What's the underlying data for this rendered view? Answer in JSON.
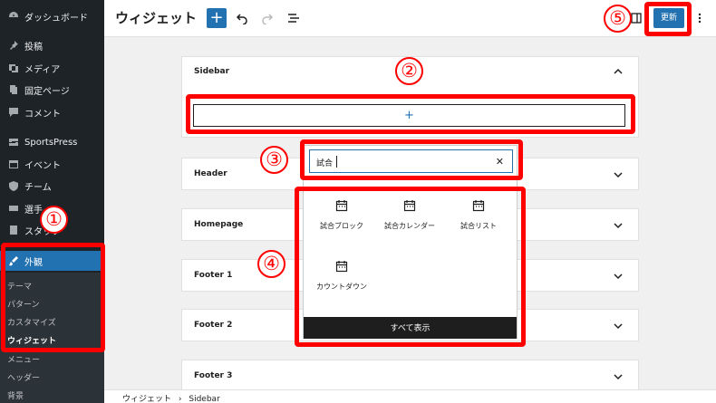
{
  "sidebar": {
    "items": [
      {
        "label": "ダッシュボード",
        "icon": "dashboard-icon"
      },
      {
        "label": "投稿",
        "icon": "pin-icon"
      },
      {
        "label": "メディア",
        "icon": "media-icon"
      },
      {
        "label": "固定ページ",
        "icon": "page-icon"
      },
      {
        "label": "コメント",
        "icon": "comment-icon"
      },
      {
        "label": "SportsPress",
        "icon": "sportspress-icon"
      },
      {
        "label": "イベント",
        "icon": "calendar-icon"
      },
      {
        "label": "チーム",
        "icon": "shield-icon"
      },
      {
        "label": "選手",
        "icon": "player-icon"
      },
      {
        "label": "スタッフ",
        "icon": "staff-icon"
      },
      {
        "label": "外観",
        "icon": "brush-icon"
      }
    ],
    "submenu": [
      "テーマ",
      "パターン",
      "カスタマイズ",
      "ウィジェット",
      "メニュー",
      "ヘッダー",
      "背景"
    ]
  },
  "header": {
    "title": "ウィジェット",
    "add_label": "+",
    "update_label": "更新"
  },
  "areas": [
    {
      "title": "Sidebar"
    },
    {
      "title": "Header"
    },
    {
      "title": "Homepage"
    },
    {
      "title": "Footer 1"
    },
    {
      "title": "Footer 2"
    },
    {
      "title": "Footer 3"
    }
  ],
  "appender_label": "+",
  "inserter": {
    "search_value": "試合",
    "clear_label": "✕",
    "blocks": [
      {
        "label": "試合ブロック",
        "icon": "calendar-icon"
      },
      {
        "label": "試合カレンダー",
        "icon": "calendar-icon"
      },
      {
        "label": "試合リスト",
        "icon": "calendar-icon"
      },
      {
        "label": "カウントダウン",
        "icon": "calendar-icon"
      }
    ],
    "show_all_label": "すべて表示"
  },
  "breadcrumb": {
    "root": "ウィジェット",
    "separator": "›",
    "current": "Sidebar"
  },
  "annotations": [
    "①",
    "②",
    "③",
    "④",
    "⑤"
  ],
  "colors": {
    "accent": "#2271b1",
    "annotation": "#ff0000",
    "sidebar_bg": "#1d2327"
  }
}
